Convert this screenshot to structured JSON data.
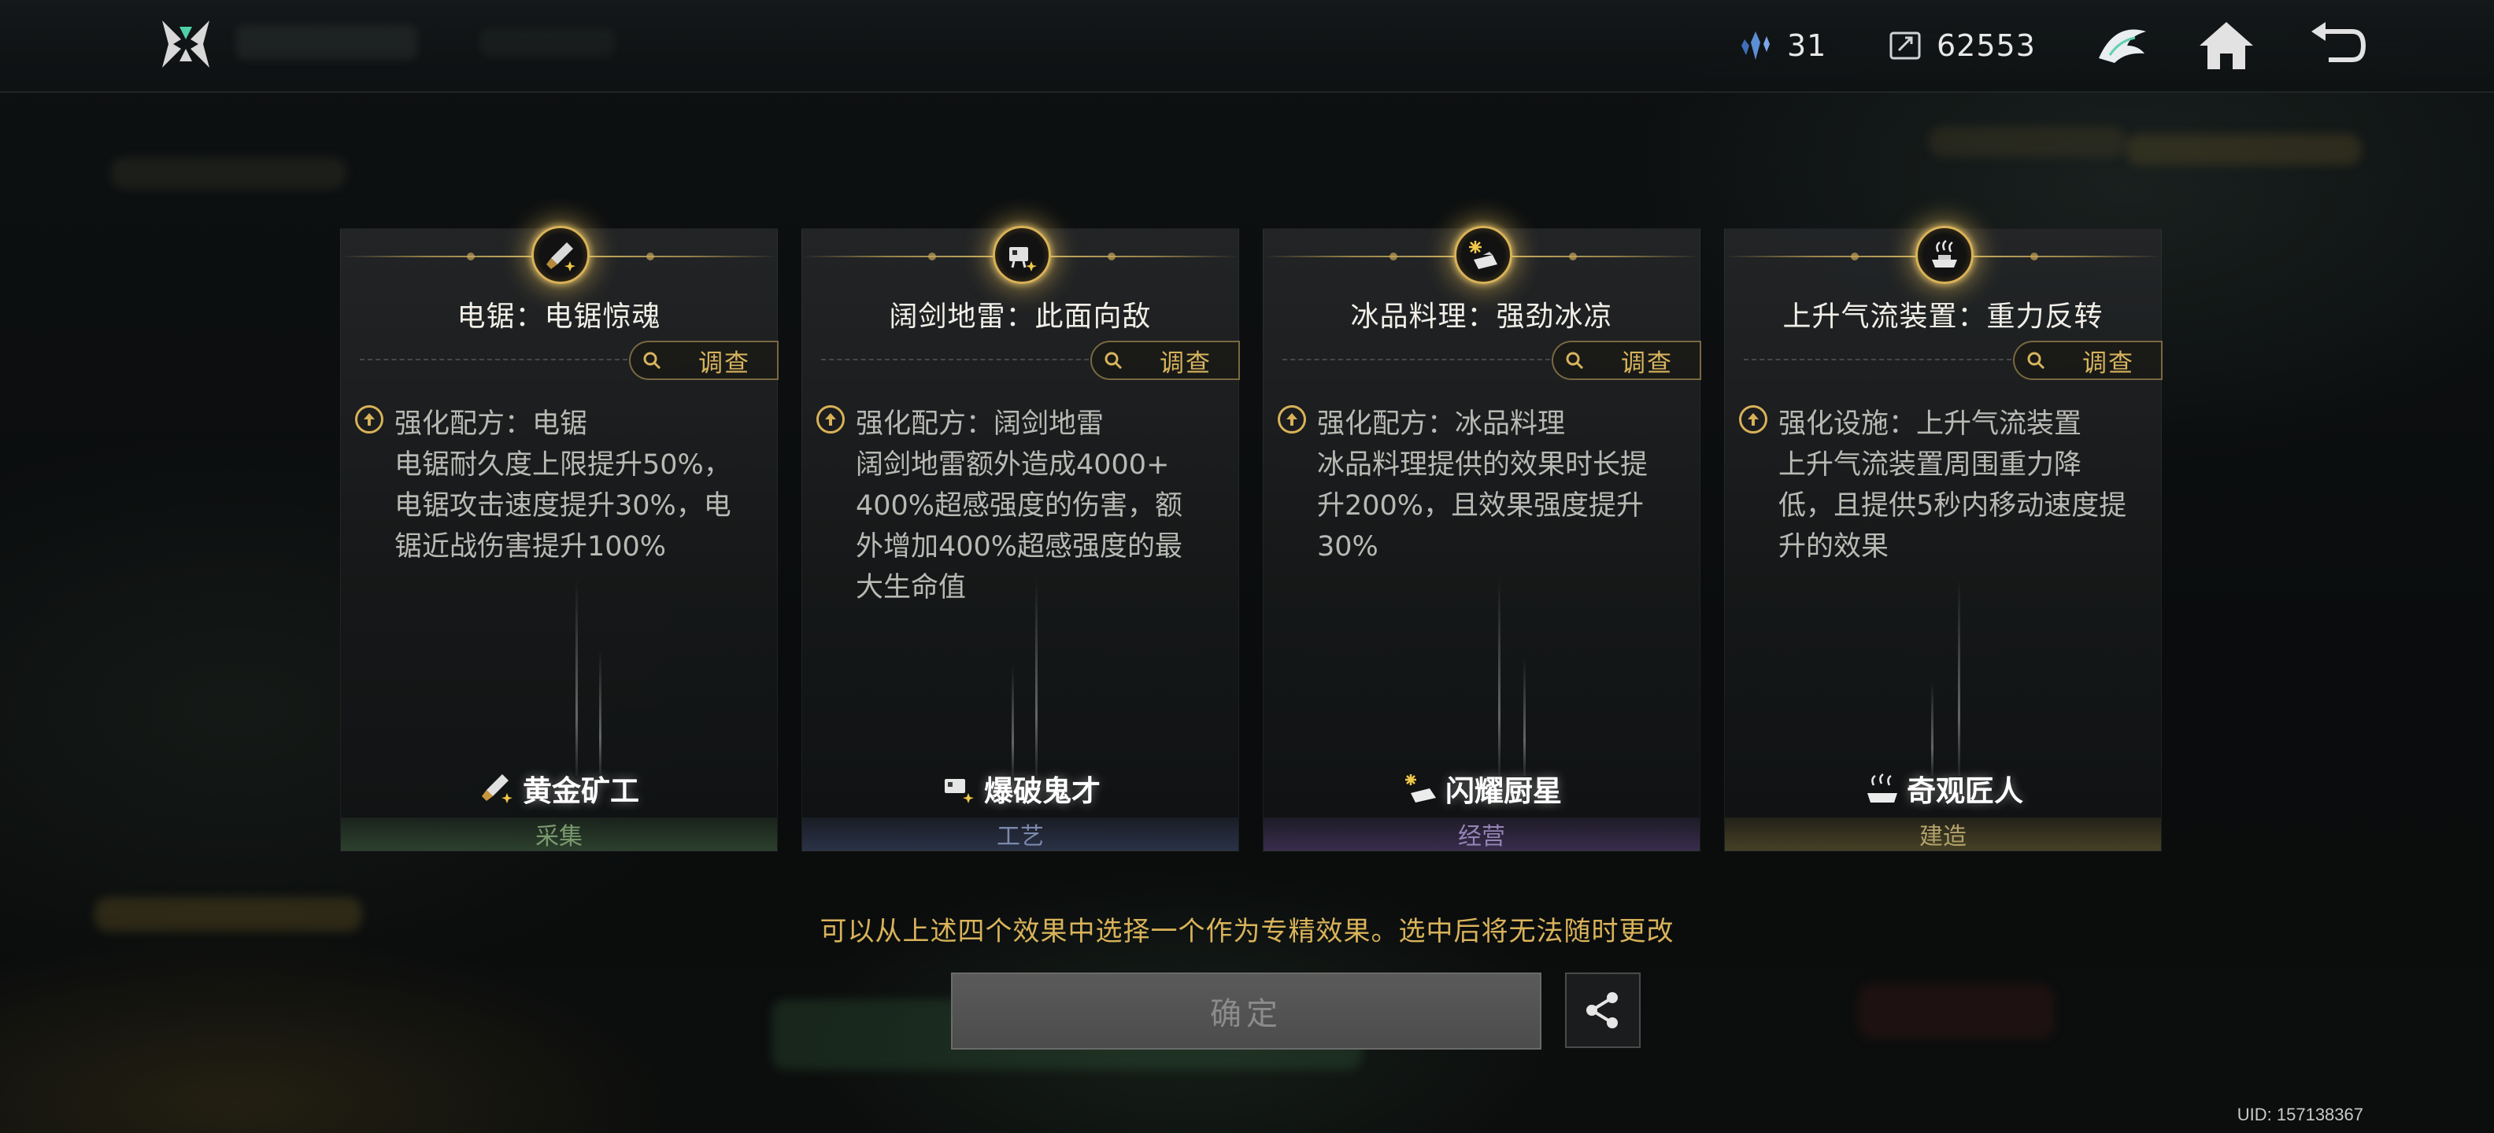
{
  "topbar": {
    "currency_a": {
      "icon": "crystal-shard-icon",
      "value": "31"
    },
    "currency_b": {
      "icon": "ticket-icon",
      "value": "62553"
    },
    "buttons": [
      "profile-emblem-icon",
      "home-icon",
      "back-icon"
    ]
  },
  "cards": [
    {
      "title": "电锯：电锯惊魂",
      "investigate": "调查",
      "desc_head": "强化配方：电锯",
      "desc_body": "电锯耐久度上限提升50%，\n电锯攻击速度提升30%，电\n锯近战伤害提升100%",
      "role": "黄金矿工",
      "category": "采集",
      "icon": "chainsaw-icon",
      "accent": "#4f7a4d",
      "cat_color": "#7b9a6f"
    },
    {
      "title": "阔剑地雷：此面向敌",
      "investigate": "调查",
      "desc_head": "强化配方：阔剑地雷",
      "desc_body": "阔剑地雷额外造成4000+\n400%超感强度的伤害，额\n外增加400%超感强度的最\n大生命值",
      "role": "爆破鬼才",
      "category": "工艺",
      "icon": "claymore-mine-icon",
      "accent": "#4b5a86",
      "cat_color": "#7c89ad"
    },
    {
      "title": "冰品料理：强劲冰凉",
      "investigate": "调查",
      "desc_head": "强化配方：冰品料理",
      "desc_body": "冰品料理提供的效果时长提\n升200%，且效果强度提升\n30%",
      "role": "闪耀厨星",
      "category": "经营",
      "icon": "ice-dish-icon",
      "accent": "#6a4f94",
      "cat_color": "#9484b5"
    },
    {
      "title": "上升气流装置：重力反转",
      "investigate": "调查",
      "desc_head": "强化设施：上升气流装置",
      "desc_body": "上升气流装置周围重力降\n低，且提供5秒内移动速度提\n升的效果",
      "role": "奇观匠人",
      "category": "建造",
      "icon": "updraft-device-icon",
      "accent": "#8a7a3c",
      "cat_color": "#b3a26a"
    }
  ],
  "notice": "可以从上述四个效果中选择一个作为专精效果。选中后将无法随时更改",
  "confirm_label": "确定",
  "uid": "UID: 157138367"
}
